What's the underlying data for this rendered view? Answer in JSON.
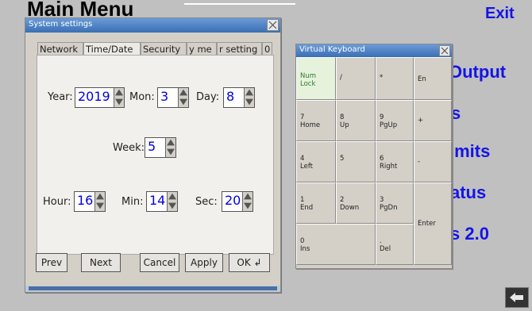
{
  "background": {
    "title": "Main Menu",
    "exit": "Exit",
    "items": [
      "Output",
      "s",
      "imits",
      "atus",
      "s 2.0"
    ]
  },
  "settings": {
    "title": "System settings",
    "tabs": [
      "Network",
      "Time/Date",
      "Security",
      "y me",
      "r setting",
      "0"
    ],
    "fields": {
      "year": {
        "label": "Year:",
        "value": "2019"
      },
      "mon": {
        "label": "Mon:",
        "value": "3"
      },
      "day": {
        "label": "Day:",
        "value": "8"
      },
      "week": {
        "label": "Week:",
        "value": "5"
      },
      "hour": {
        "label": "Hour:",
        "value": "16"
      },
      "min": {
        "label": "Min:",
        "value": "14"
      },
      "sec": {
        "label": "Sec:",
        "value": "20"
      }
    },
    "buttons": {
      "prev": "Prev",
      "next": "Next",
      "cancel": "Cancel",
      "apply": "Apply",
      "ok": "OK ↲"
    }
  },
  "keyboard": {
    "title": "Virtual Keyboard",
    "keys": {
      "numlock": "Num\nLock",
      "slash": "/",
      "star": "*",
      "en": "En",
      "k7": "7\nHome",
      "k8": "8\nUp",
      "k9": "9\nPgUp",
      "plus": "+",
      "k4": "4\nLeft",
      "k5": "5",
      "k6": "6\nRight",
      "minus": "-",
      "k1": "1\nEnd",
      "k2": "2\nDown",
      "k3": "3\nPgDn",
      "enter": "Enter",
      "k0": "0\nIns",
      "dot": ".\nDel"
    }
  },
  "icons": {
    "back": "back-arrow-icon",
    "close": "close-icon",
    "spin_up": "spin-up-icon",
    "spin_down": "spin-down-icon"
  }
}
